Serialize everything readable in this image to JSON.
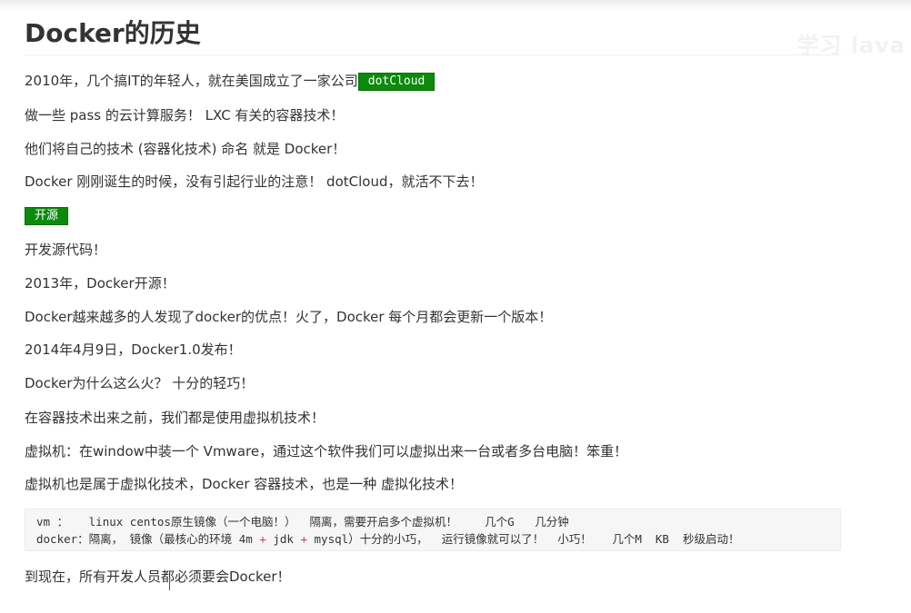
{
  "watermark": "学习 lava",
  "doc": {
    "title": "Docker的历史",
    "p1_text": "2010年，几个搞IT的年轻人，就在美国成立了一家公司",
    "p1_tag": "dotCloud",
    "p2": "做一些  pass 的云计算服务！  LXC  有关的容器技术！",
    "p3": "他们将自己的技术 (容器化技术)  命名 就是 Docker！",
    "p4": "Docker 刚刚诞生的时候，没有引起行业的注意！ dotCloud，就活不下去！",
    "tag_open": "开源",
    "p5": "开发源代码！",
    "p6": "2013年，Docker开源！",
    "p7": "Docker越来越多的人发现了docker的优点！火了，Docker 每个月都会更新一个版本！",
    "p8": "2014年4月9日，Docker1.0发布！",
    "p9": "Docker为什么这么火？ 十分的轻巧！",
    "p10": "在容器技术出来之前，我们都是使用虚拟机技术！",
    "p11": "虚拟机：在window中装一个 Vmware，通过这个软件我们可以虚拟出来一台或者多台电脑！笨重！",
    "p12": "虚拟机也是属于虚拟化技术，Docker 容器技术，也是一种 虚拟化技术！",
    "code": {
      "line1": "vm ：   linux centos原生镜像（一个电脑！）  隔离，需要开启多个虚拟机！    几个G   几分钟",
      "line2_a": "docker：隔离， 镜像（最核心的环境 4m ",
      "line2_plus1": "+",
      "line2_b": " jdk ",
      "line2_plus2": "+",
      "line2_c": " mysql）十分的小巧，  运行镜像就可以了！  小巧！   几个M  KB  秒级启动！"
    },
    "p13": "到现在，所有开发人员都必须要会Docker！"
  }
}
